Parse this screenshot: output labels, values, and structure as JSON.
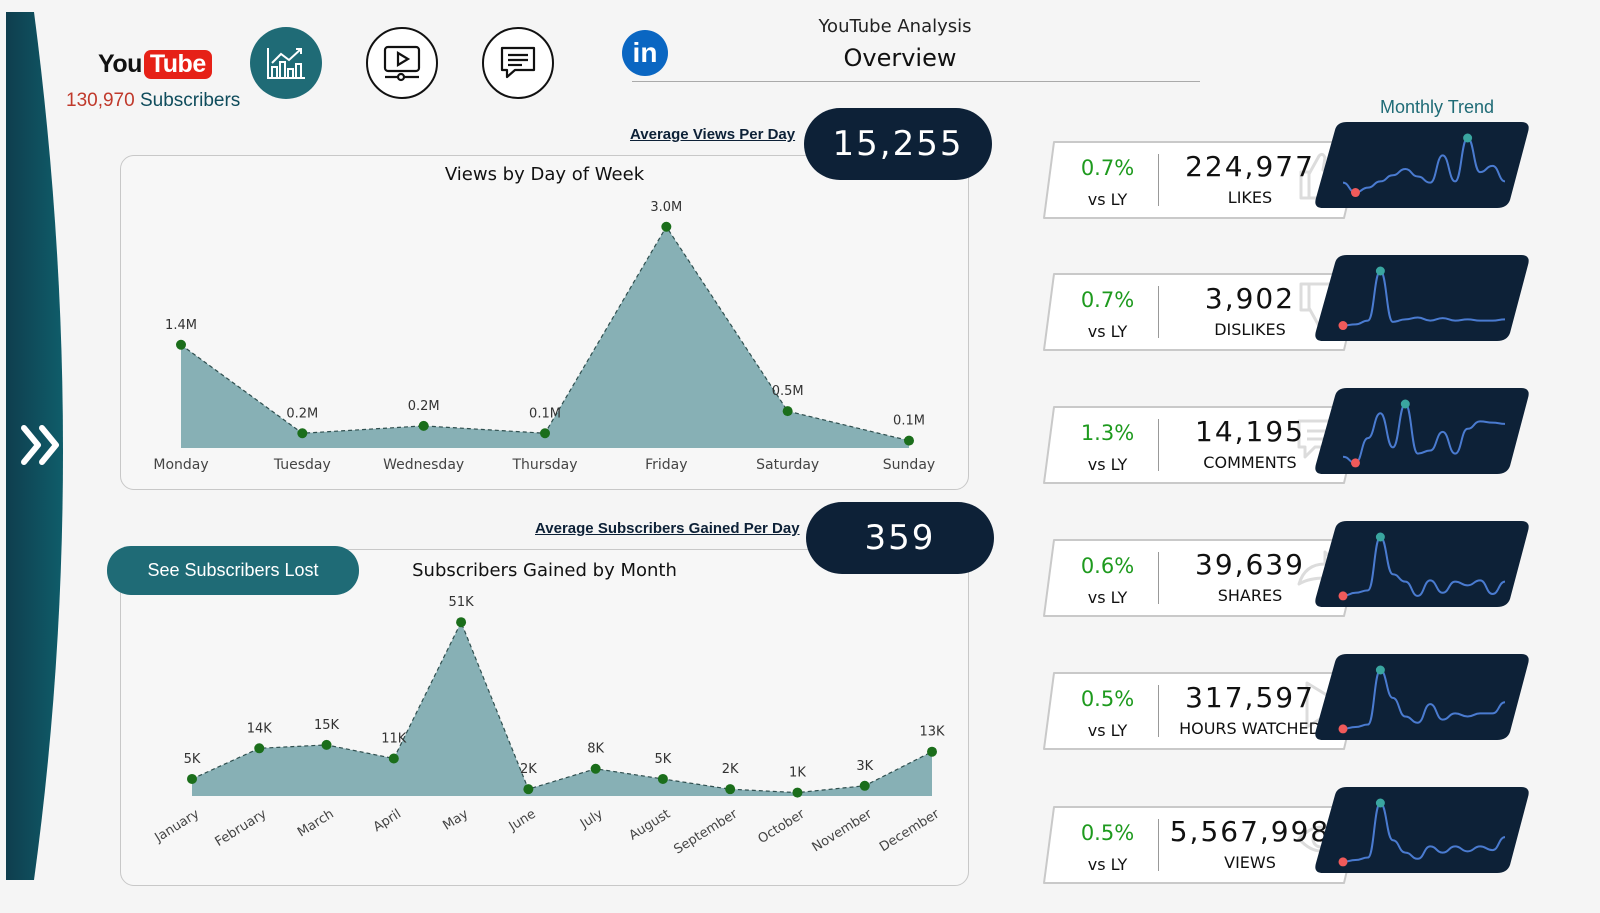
{
  "header": {
    "logo": {
      "you": "You",
      "tube": "Tube"
    },
    "subscribers_count": "130,970",
    "subscribers_label": "Subscribers",
    "title": "YouTube Analysis",
    "subtitle": "Overview",
    "linkedin_text": "in"
  },
  "nav": [
    {
      "icon": "analytics-chart-icon",
      "active": true
    },
    {
      "icon": "video-play-icon",
      "active": false
    },
    {
      "icon": "comment-icon",
      "active": false
    }
  ],
  "avg_views": {
    "label": "Average Views Per Day",
    "value": "15,255"
  },
  "avg_subs": {
    "label": "Average Subscribers Gained Per Day",
    "value": "359"
  },
  "see_lost_button": "See Subscribers Lost",
  "monthly_trend_title": "Monthly Trend",
  "kpis": [
    {
      "pct": "0.7%",
      "vs": "vs LY",
      "value": "224,977",
      "label": "LIKES",
      "icon": "thumbs-up-icon",
      "trend": [
        0.28,
        0.12,
        0.2,
        0.3,
        0.4,
        0.5,
        0.38,
        0.28,
        0.72,
        0.3,
        1.0,
        0.45,
        0.55,
        0.3
      ]
    },
    {
      "pct": "0.7%",
      "vs": "vs LY",
      "value": "3,902",
      "label": "DISLIKES",
      "icon": "thumbs-down-icon",
      "trend": [
        0.12,
        0.14,
        0.2,
        1.0,
        0.18,
        0.22,
        0.25,
        0.2,
        0.24,
        0.2,
        0.22,
        0.2,
        0.2,
        0.22
      ]
    },
    {
      "pct": "1.3%",
      "vs": "vs LY",
      "value": "14,195",
      "label": "COMMENTS",
      "icon": "chat-bubble-icon",
      "trend": [
        0.15,
        0.05,
        0.45,
        0.85,
        0.3,
        1.0,
        0.2,
        0.25,
        0.55,
        0.2,
        0.6,
        0.72,
        0.7,
        0.68
      ]
    },
    {
      "pct": "0.6%",
      "vs": "vs LY",
      "value": "39,639",
      "label": "SHARES",
      "icon": "share-arrow-icon",
      "trend": [
        0.05,
        0.1,
        0.14,
        1.0,
        0.4,
        0.28,
        0.05,
        0.3,
        0.1,
        0.28,
        0.22,
        0.3,
        0.08,
        0.28
      ]
    },
    {
      "pct": "0.5%",
      "vs": "vs LY",
      "value": "317,597",
      "label": "HOURS WATCHED",
      "icon": "play-icon",
      "trend": [
        0.05,
        0.08,
        0.12,
        1.0,
        0.55,
        0.25,
        0.15,
        0.45,
        0.2,
        0.3,
        0.25,
        0.3,
        0.3,
        0.48
      ]
    },
    {
      "pct": "0.5%",
      "vs": "vs LY",
      "value": "5,567,998",
      "label": "VIEWS",
      "icon": "eye-icon",
      "trend": [
        0.05,
        0.08,
        0.12,
        1.0,
        0.4,
        0.2,
        0.1,
        0.3,
        0.2,
        0.3,
        0.22,
        0.3,
        0.24,
        0.45
      ]
    }
  ],
  "chart_data": [
    {
      "type": "area",
      "title": "Views by Day of Week",
      "categories": [
        "Monday",
        "Tuesday",
        "Wednesday",
        "Thursday",
        "Friday",
        "Saturday",
        "Sunday"
      ],
      "values": [
        1.4,
        0.2,
        0.3,
        0.2,
        3.0,
        0.5,
        0.1
      ],
      "data_labels": [
        "1.4M",
        "0.2M",
        "0.2M",
        "0.1M",
        "3.0M",
        "0.5M",
        "0.1M"
      ],
      "unit": "M",
      "ylim": [
        0,
        3.2
      ],
      "grid": false
    },
    {
      "type": "area",
      "title": "Subscribers Gained by Month",
      "categories": [
        "January",
        "February",
        "March",
        "April",
        "May",
        "June",
        "July",
        "August",
        "September",
        "October",
        "November",
        "December"
      ],
      "values": [
        5,
        14,
        15,
        11,
        51,
        2,
        8,
        5,
        2,
        1,
        3,
        13
      ],
      "data_labels": [
        "5K",
        "14K",
        "15K",
        "11K",
        "51K",
        "2K",
        "8K",
        "5K",
        "2K",
        "1K",
        "3K",
        "13K"
      ],
      "unit": "K",
      "ylim": [
        0,
        54
      ],
      "grid": false
    }
  ],
  "colors": {
    "navy": "#0d2137",
    "teal": "#1f6b76",
    "area_fill": "#87b0b5",
    "point": "#1b6e1b",
    "positive": "#1e9a1e",
    "spark_line": "#4a7bd0",
    "spark_max": "#3aa6a0",
    "spark_min": "#f05a5a",
    "youtube_red": "#e62117",
    "linkedin": "#0a66c2"
  }
}
